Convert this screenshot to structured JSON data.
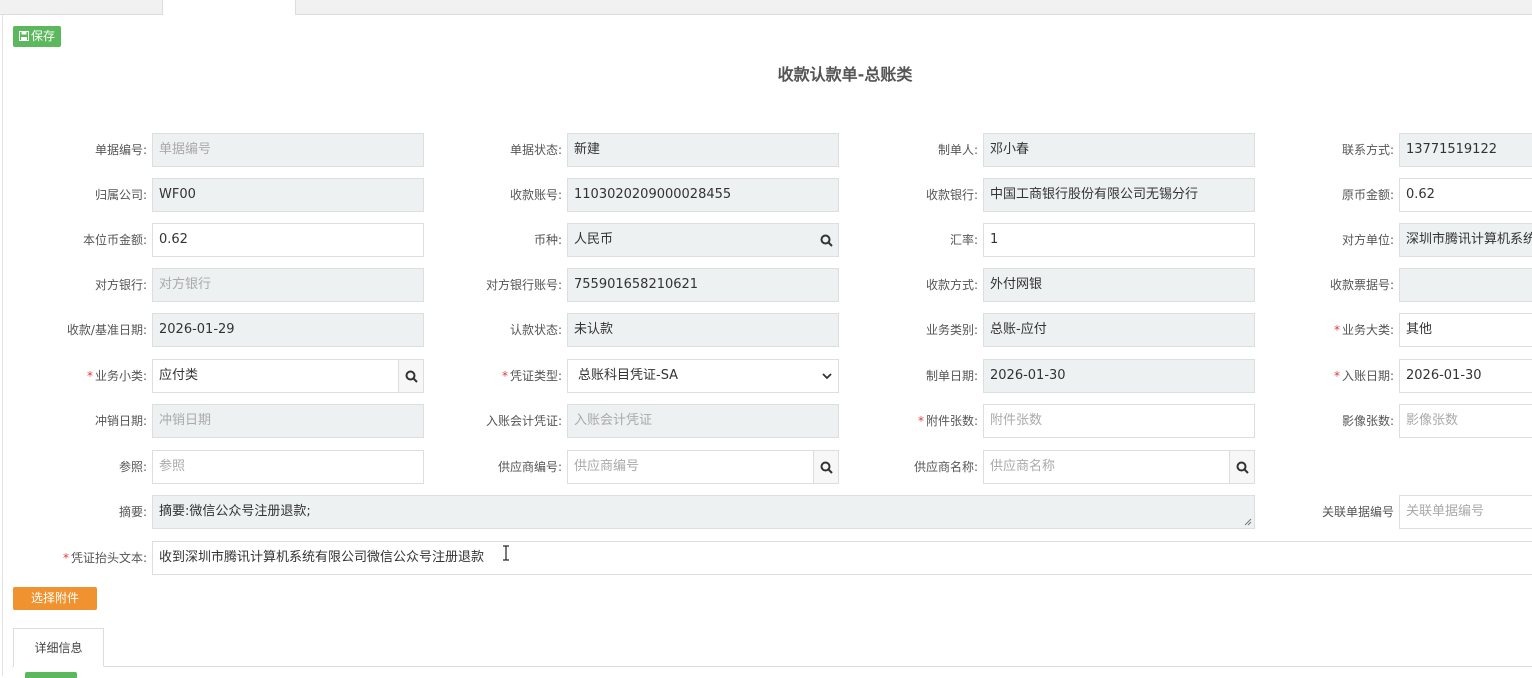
{
  "toolbar": {
    "save_label": "保存"
  },
  "title": "收款认款单-总账类",
  "fields": {
    "doc_no": {
      "label": "单据编号:",
      "placeholder": "单据编号",
      "value": ""
    },
    "doc_status": {
      "label": "单据状态:",
      "value": "新建"
    },
    "creator": {
      "label": "制单人:",
      "value": "邓小春"
    },
    "contact": {
      "label": "联系方式:",
      "value": "13771519122"
    },
    "company": {
      "label": "归属公司:",
      "value": "WF00"
    },
    "receive_acct": {
      "label": "收款账号:",
      "value": "1103020209000028455"
    },
    "receive_bank": {
      "label": "收款银行:",
      "value": "中国工商银行股份有限公司无锡分行"
    },
    "orig_amount": {
      "label": "原币金额:",
      "value": "0.62"
    },
    "local_amount": {
      "label": "本位币金额:",
      "value": "0.62"
    },
    "currency": {
      "label": "币种:",
      "value": "人民币"
    },
    "rate": {
      "label": "汇率:",
      "value": "1"
    },
    "counterparty": {
      "label": "对方单位:",
      "value": "深圳市腾讯计算机系统"
    },
    "cp_bank": {
      "label": "对方银行:",
      "placeholder": "对方银行",
      "value": ""
    },
    "cp_bank_acct": {
      "label": "对方银行账号:",
      "value": "755901658210621"
    },
    "receive_method": {
      "label": "收款方式:",
      "value": "外付网银"
    },
    "receipt_no": {
      "label": "收款票据号:",
      "value": ""
    },
    "base_date": {
      "label": "收款/基准日期:",
      "value": "2026-01-29"
    },
    "claim_status": {
      "label": "认款状态:",
      "value": "未认款"
    },
    "biz_category": {
      "label": "业务类别:",
      "value": "总账-应付"
    },
    "biz_major": {
      "label": "业务大类:",
      "value": "其他"
    },
    "biz_minor": {
      "label": "业务小类:",
      "value": "应付类"
    },
    "voucher_type": {
      "label": "凭证类型:",
      "value": "总账科目凭证-SA"
    },
    "create_date": {
      "label": "制单日期:",
      "value": "2026-01-30"
    },
    "post_date": {
      "label": "入账日期:",
      "value": "2026-01-30"
    },
    "writeoff_date": {
      "label": "冲销日期:",
      "placeholder": "冲销日期",
      "value": ""
    },
    "acct_voucher": {
      "label": "入账会计凭证:",
      "placeholder": "入账会计凭证",
      "value": ""
    },
    "attach_count": {
      "label": "附件张数:",
      "placeholder": "附件张数",
      "value": ""
    },
    "image_count": {
      "label": "影像张数:",
      "placeholder": "影像张数",
      "value": ""
    },
    "reference": {
      "label": "参照:",
      "placeholder": "参照",
      "value": ""
    },
    "supplier_no": {
      "label": "供应商编号:",
      "placeholder": "供应商编号",
      "value": ""
    },
    "supplier_name": {
      "label": "供应商名称:",
      "placeholder": "供应商名称",
      "value": ""
    },
    "summary": {
      "label": "摘要:",
      "value": "摘要:微信公众号注册退款;"
    },
    "related_no": {
      "label": "关联单据编号",
      "placeholder": "关联单据编号",
      "value": ""
    },
    "header_text": {
      "label": "凭证抬头文本:",
      "value": "收到深圳市腾讯计算机系统有限公司微信公众号注册退款"
    }
  },
  "buttons": {
    "attach_label": "选择附件"
  },
  "detail_tab": {
    "label": "详细信息"
  },
  "colors": {
    "save": "#5cb85c",
    "attach": "#f0922f",
    "readonly_bg": "#eef1f1",
    "required": "#e4393c"
  },
  "icons": [
    "save-icon",
    "search-icon",
    "chevron-down-icon",
    "resize-handle-icon",
    "text-cursor-icon"
  ]
}
